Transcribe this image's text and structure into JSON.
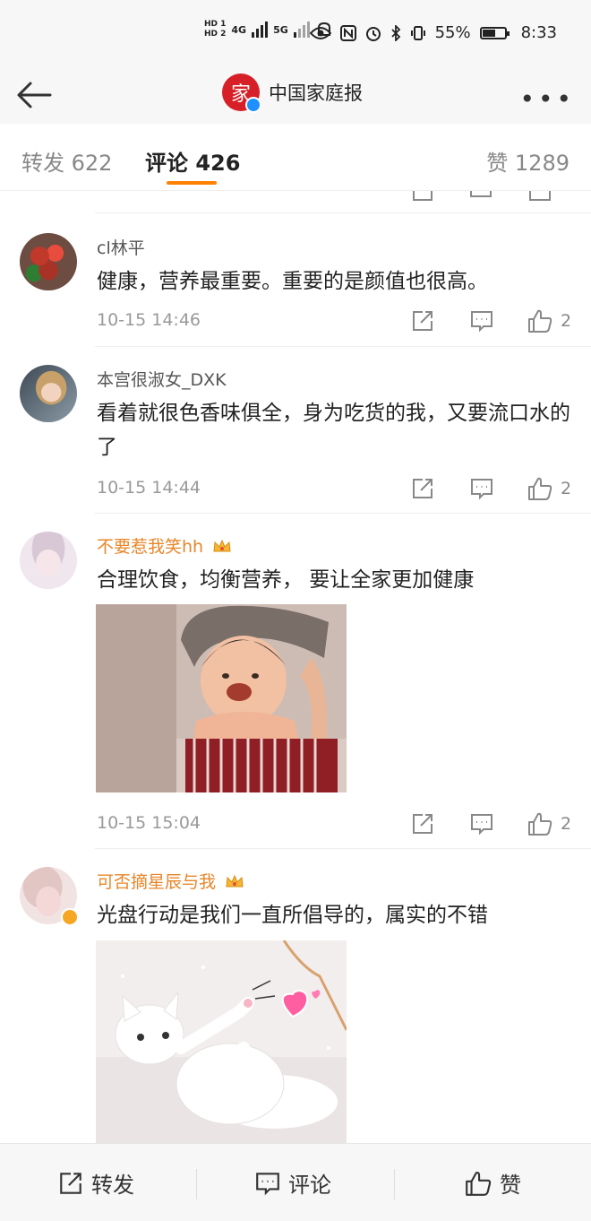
{
  "status_bar": {
    "hd1": "HD 1",
    "hd2": "HD 2",
    "net1": "4G",
    "net2": "5G",
    "battery": "55%",
    "time": "8:33"
  },
  "nav": {
    "logo_char": "家",
    "title": "中国家庭报",
    "more": "•••"
  },
  "tabs": {
    "repost": "转发 622",
    "comment": "评论 426",
    "like": "赞 1289"
  },
  "comments": [
    {
      "name": "cl林平",
      "text": "健康，营养最重要。重要的是颜值也很高。",
      "time": "10-15 14:46",
      "likes": "2"
    },
    {
      "name": "本宫很淑女_DXK",
      "text": "看着就很色香味俱全，身为吃货的我，又要流口水的了",
      "time": "10-15 14:44",
      "likes": "2"
    },
    {
      "name": "不要惹我笑hh",
      "text": "合理饮食，均衡营养， 要让全家更加健康",
      "time": "10-15 15:04",
      "likes": "2"
    },
    {
      "name": "可否摘星辰与我",
      "text": "光盘行动是我们一直所倡导的，属实的不错"
    }
  ],
  "bottom_bar": {
    "repost": "转发",
    "comment": "评论",
    "like": "赞"
  },
  "colors": {
    "accent": "#ff8200",
    "vip_name": "#e8862a",
    "brand_red": "#d61f26"
  }
}
